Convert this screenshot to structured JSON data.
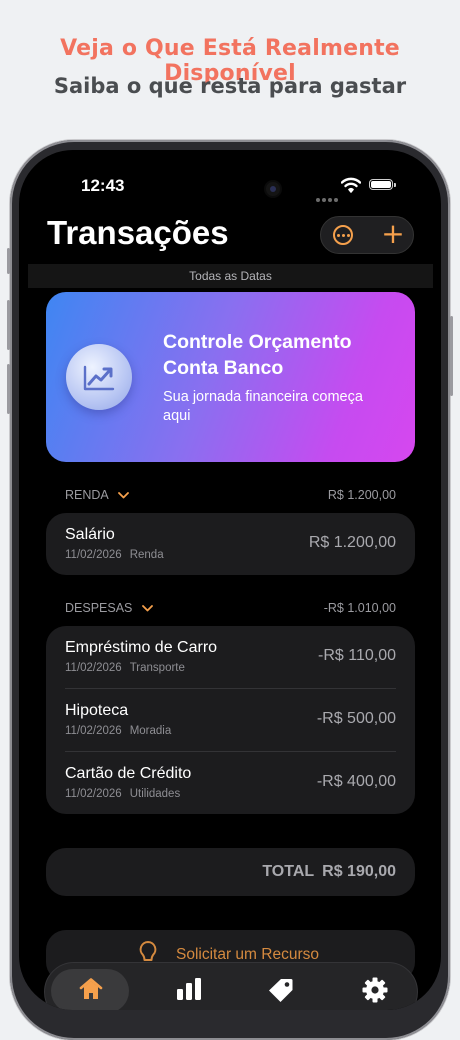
{
  "promo": {
    "headline": "Veja o Que Está Realmente Disponível",
    "subheadline": "Saiba o que resta para gastar"
  },
  "status_bar": {
    "time": "12:43"
  },
  "header": {
    "title": "Transações"
  },
  "filter": {
    "label": "Todas as Datas"
  },
  "banner": {
    "title": "Controle Orçamento Conta Banco",
    "subtitle": "Sua jornada financeira começa aqui"
  },
  "income": {
    "label": "RENDA",
    "total": "R$ 1.200,00",
    "items": [
      {
        "name": "Salário",
        "date": "11/02/2026",
        "category": "Renda",
        "amount": "R$ 1.200,00"
      }
    ]
  },
  "expenses": {
    "label": "DESPESAS",
    "total": "-R$ 1.010,00",
    "items": [
      {
        "name": "Empréstimo de Carro",
        "date": "11/02/2026",
        "category": "Transporte",
        "amount": "-R$ 110,00"
      },
      {
        "name": "Hipoteca",
        "date": "11/02/2026",
        "category": "Moradia",
        "amount": "-R$ 500,00"
      },
      {
        "name": "Cartão de Crédito",
        "date": "11/02/2026",
        "category": "Utilidades",
        "amount": "-R$ 400,00"
      }
    ]
  },
  "summary": {
    "label": "TOTAL",
    "value": "R$ 190,00"
  },
  "request": {
    "label": "Solicitar um Recurso"
  },
  "colors": {
    "accent": "#f5a04c",
    "promo": "#f2735f"
  },
  "tabs": [
    {
      "icon": "home-icon",
      "active": true
    },
    {
      "icon": "chart-bars-icon",
      "active": false
    },
    {
      "icon": "tag-icon",
      "active": false
    },
    {
      "icon": "gear-icon",
      "active": false
    }
  ]
}
